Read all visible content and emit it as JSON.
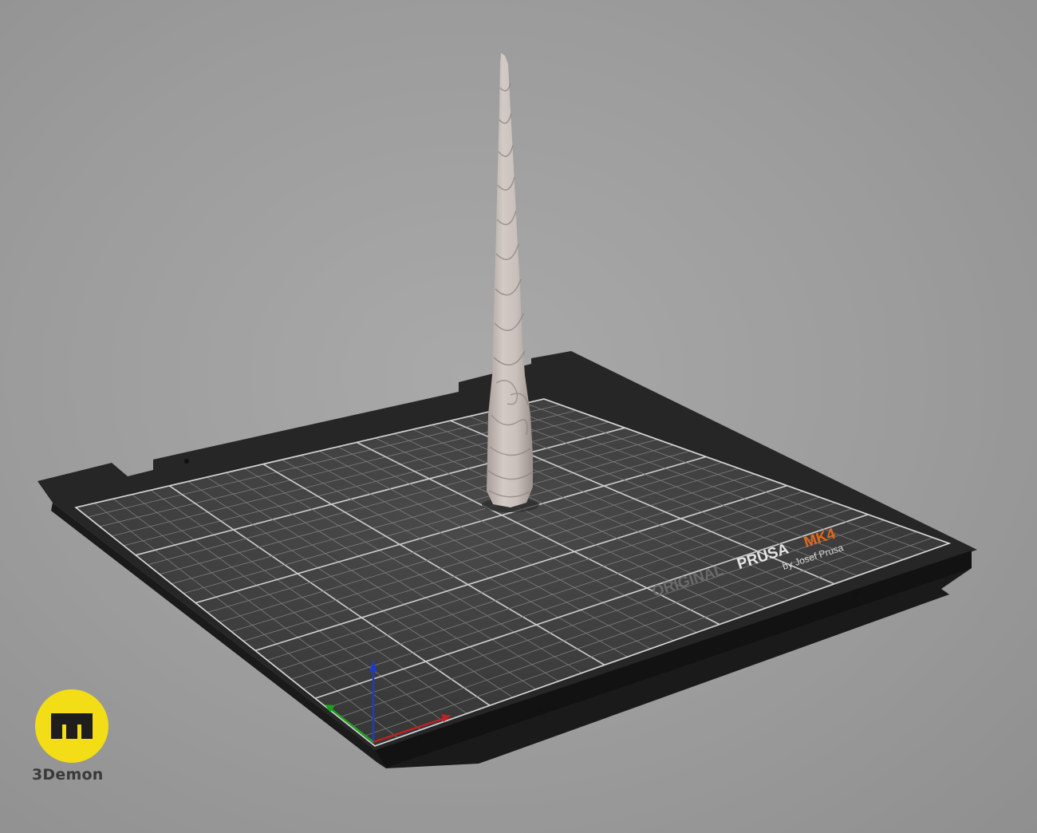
{
  "scene": {
    "bed_label": {
      "original": "ORIGINAL",
      "prusa": "PRUSA",
      "model": "MK4",
      "byline": "by Josef Prusa"
    },
    "object": "unicorn-horn-model",
    "axes": {
      "x_color": "#c02020",
      "y_color": "#20a020",
      "z_color": "#1a3cc8"
    },
    "accent_color": "#e5671c"
  },
  "watermark": {
    "text": "3Demon",
    "badge_color": "#f2dd17"
  }
}
